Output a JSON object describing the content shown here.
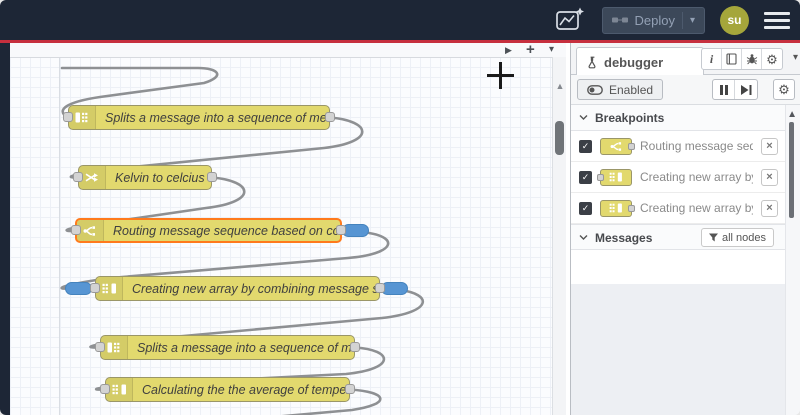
{
  "glyphs": {
    "caret_down": "▾",
    "plus": "+",
    "tab_scroll": "▶",
    "scroll_up": "▲",
    "gear": "⚙",
    "close": "×",
    "check": "✓",
    "info": "i"
  },
  "header": {
    "deploy_label": "Deploy",
    "avatar_text": "su"
  },
  "canvas": {
    "nodes": [
      {
        "type": "split",
        "label": "Splits a message into a sequence of messages."
      },
      {
        "type": "change",
        "label": "Kelvin to celcius"
      },
      {
        "type": "switch",
        "label": "Routing message sequence based on condition",
        "highlighted": true
      },
      {
        "type": "join",
        "label": "Creating new array by combining message sequence"
      },
      {
        "type": "split",
        "label": "Splits a message into a sequence of messages."
      },
      {
        "type": "join",
        "label": "Calculating the the average of temperature"
      }
    ]
  },
  "sidebar": {
    "tab_label": "debugger",
    "enabled_label": "Enabled",
    "breakpoints_title": "Breakpoints",
    "breakpoint_items": [
      {
        "label": "Routing message sequence based on condition",
        "node_type": "switch",
        "port": "output",
        "checked": true
      },
      {
        "label": "Creating new array by combining message sequence",
        "node_type": "join",
        "port": "input",
        "checked": true
      },
      {
        "label": "Creating new array by combining message sequence",
        "node_type": "join",
        "port": "output",
        "checked": true
      }
    ],
    "messages_title": "Messages",
    "filter_label": "all nodes"
  },
  "colors": {
    "header_bg": "#1d2636",
    "accent_red": "#c62f3e",
    "node_yellow": "#e2d96e",
    "highlight_orange": "#ff7a1c",
    "badge_blue": "#5795d3",
    "avatar_olive": "#a5a63b"
  }
}
